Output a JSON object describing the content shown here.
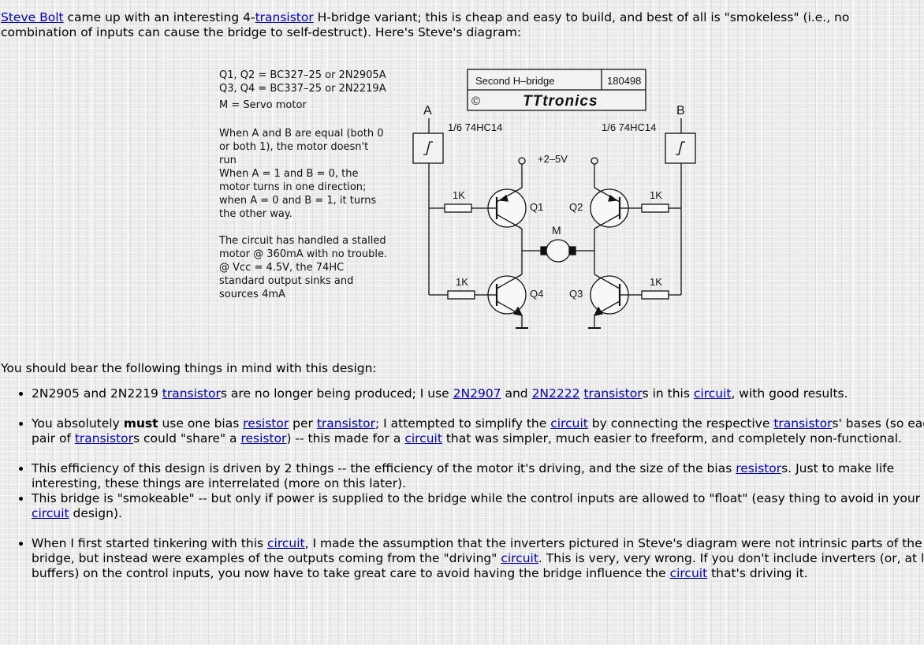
{
  "intro": {
    "link_steve": "Steve Bolt",
    "text1": " came up with an interesting 4-",
    "link_transistor": "transistor",
    "text2": " H-bridge variant; this is cheap and easy to build, and best of all is \"smokeless\" (i.e., no combination of inputs can cause the bridge to self-destruct). Here's Steve's diagram:"
  },
  "diagram": {
    "notes": {
      "parts1": "Q1, Q2 = BC327–25 or 2N2905A",
      "parts2": "Q3, Q4 = BC337–25 or 2N2219A",
      "parts3": "M = Servo motor",
      "para1": "When A and B are equal (both 0 or both 1), the motor doesn't run",
      "para2": "When A = 1 and B = 0, the motor turns in one direction; when A = 0 and B = 1, it turns the other way.",
      "para3": "The circuit has handled a stalled motor @ 360mA with no trouble.",
      "para4": "@ Vcc = 4.5V, the 74HC standard output sinks and sources 4mA"
    },
    "title_box": {
      "title": "Second H–bridge",
      "code": "180498",
      "copyright": "©",
      "brand": "TTtronics"
    },
    "labels": {
      "input_a": "A",
      "input_b": "B",
      "gate_a": "1/6 74HC14",
      "gate_b": "1/6 74HC14",
      "supply": "+2–5V",
      "r1": "1K",
      "r2": "1K",
      "r3": "1K",
      "r4": "1K",
      "q1": "Q1",
      "q2": "Q2",
      "q3": "Q3",
      "q4": "Q4",
      "motor": "M"
    }
  },
  "body": {
    "lead": "You should bear the following things in mind with this design:",
    "b1": {
      "t1": "2N2905 and 2N2219 ",
      "l1": "transistor",
      "t2": "s are no longer being produced; I use ",
      "l2": "2N2907",
      "t3": " and ",
      "l3": "2N2222",
      "t4": " ",
      "l4": "transistor",
      "t5": "s in this ",
      "l5": "circuit",
      "t6": ", with good results."
    },
    "b2": {
      "t1": "You absolutely ",
      "bold": "must",
      "t2": " use one bias ",
      "l1": "resistor",
      "t3": " per ",
      "l2": "transistor",
      "t4": "; I attempted to simplify the ",
      "l3": "circuit",
      "t5": " by connecting the respective ",
      "l4": "transistor",
      "t6": "s' bases (so each pair of ",
      "l5": "transistor",
      "t7": "s could \"share\" a ",
      "l6": "resistor",
      "t8": ") -- this made for a ",
      "l7": "circuit",
      "t9": " that was simpler, much easier to freeform, and completely non-functional."
    },
    "b3": {
      "t1": "This efficiency of this design is driven by 2 things -- the efficiency of the motor it's driving, and the size of the bias ",
      "l1": "resistor",
      "t2": "s. Just to make life interesting, these things are interrelated (more on this later)."
    },
    "b4": {
      "t1": "This bridge is \"smokeable\" -- but only if power is supplied to the bridge while the control inputs are allowed to \"float\" (easy thing to avoid in your ",
      "l1": "circuit",
      "t2": " design)."
    },
    "b5": {
      "t1": "When I first started tinkering with this ",
      "l1": "circuit",
      "t2": ", I made the assumption that the inverters pictured in Steve's diagram were not intrinsic parts of the bridge, but instead were examples of the outputs coming from the \"driving\" ",
      "l2": "circuit",
      "t3": ". This is very, very wrong. If you don't include inverters (or, at least buffers) on the control inputs, you now have to take great care to avoid having the bridge influence the ",
      "l3": "circuit",
      "t4": " that's driving it."
    }
  }
}
